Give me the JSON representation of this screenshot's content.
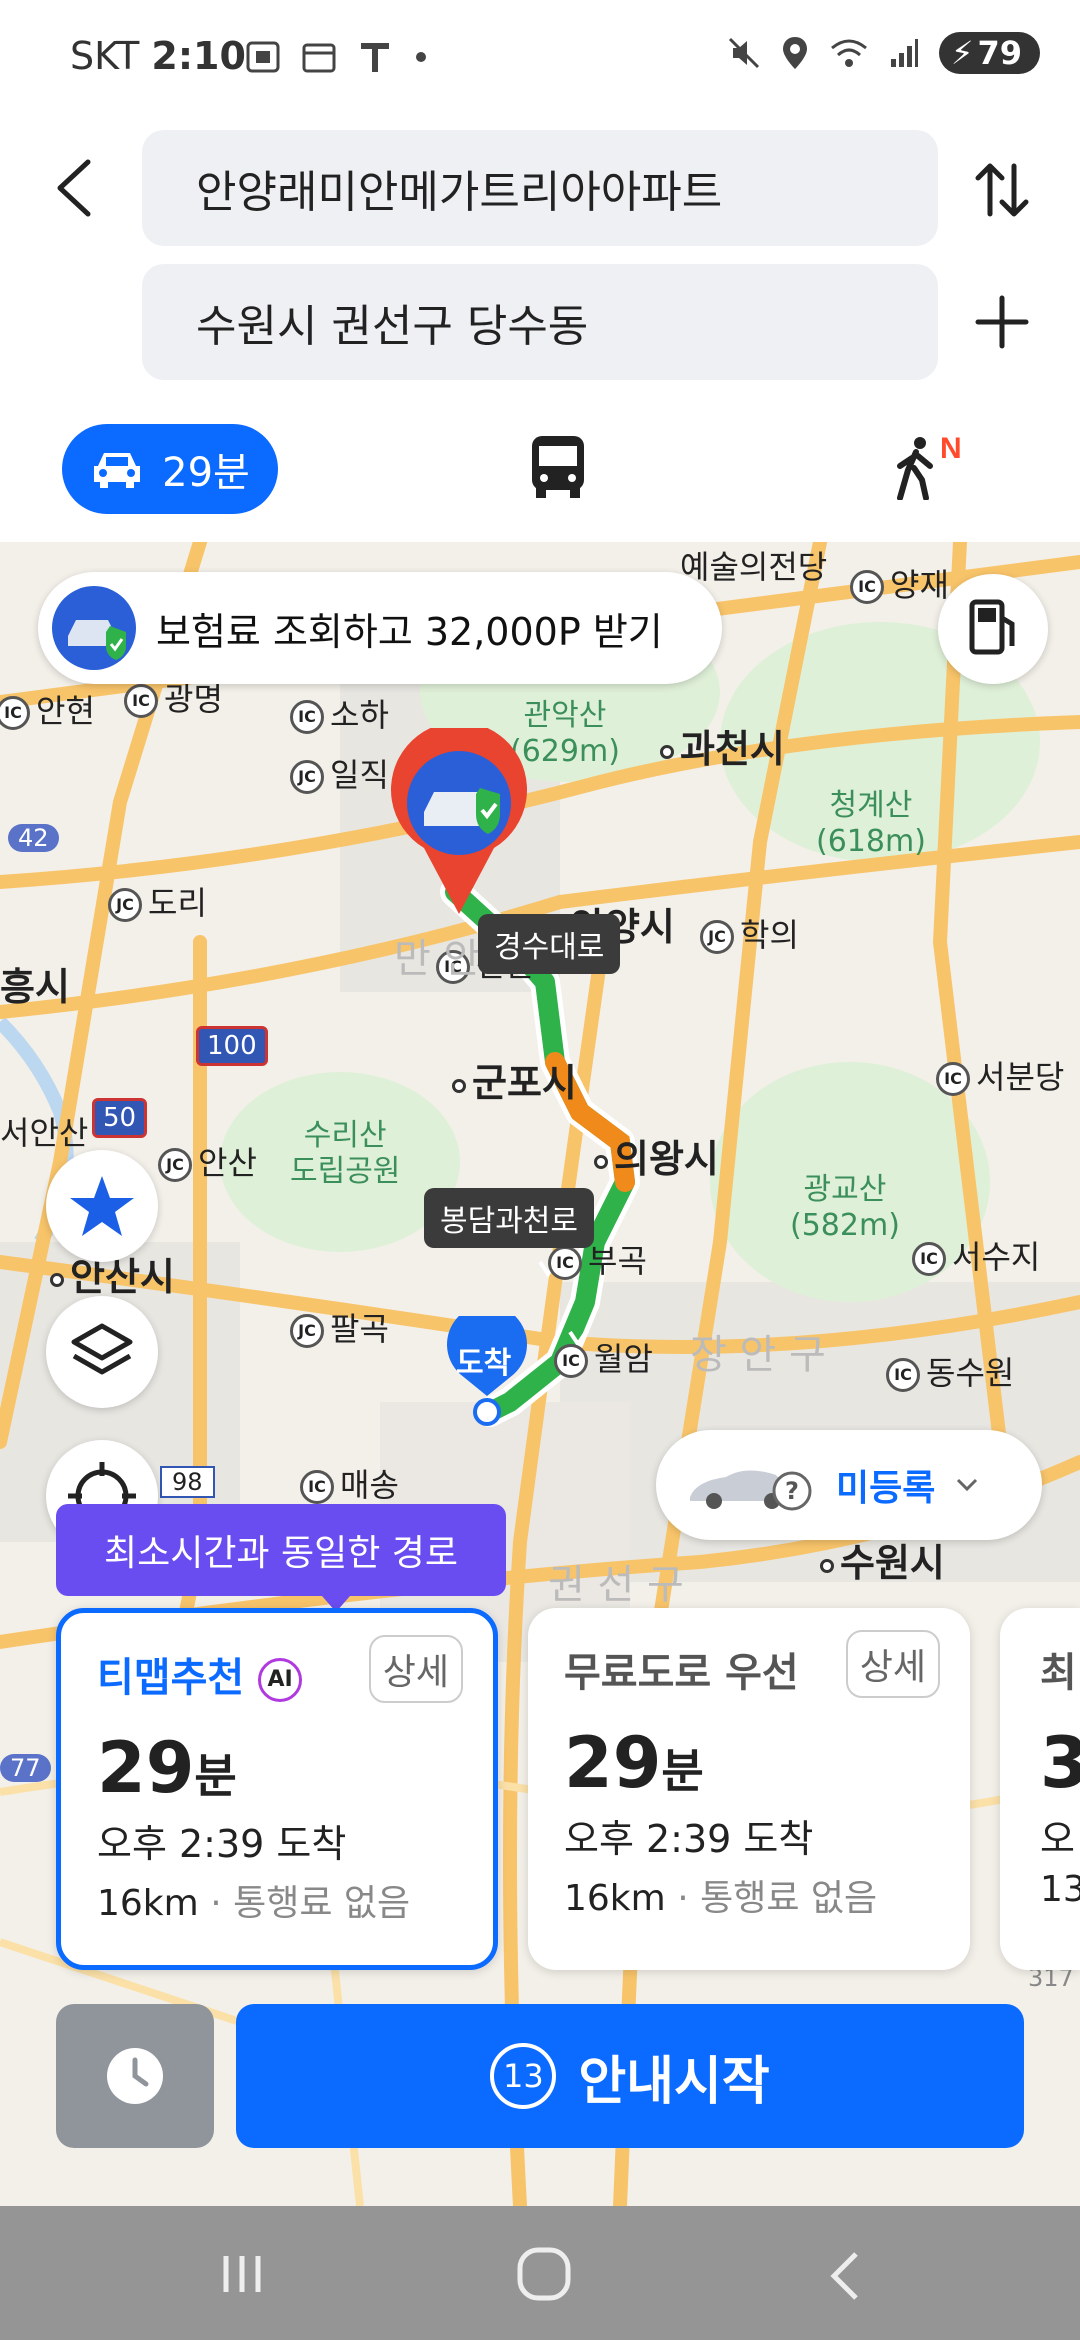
{
  "status_bar": {
    "carrier": "SKT",
    "time": "2:10",
    "battery": "79"
  },
  "search": {
    "start": "안양래미안메가트리아아파트",
    "destination": "수원시 권선구 당수동"
  },
  "modes": {
    "car_time": "29분",
    "walk_badge": "N"
  },
  "promo": {
    "text": "보험료 조회하고 32,000P 받기"
  },
  "map": {
    "labels": [
      {
        "text": "예술의전당",
        "kind": "normal"
      },
      {
        "text": "양재",
        "kind": "ic"
      },
      {
        "text": "안현",
        "kind": "ic"
      },
      {
        "text": "광명",
        "kind": "ic"
      },
      {
        "text": "소하",
        "kind": "ic"
      },
      {
        "text": "일직",
        "kind": "jc"
      },
      {
        "text": "관악산\n(629m)",
        "kind": "green"
      },
      {
        "text": "과천시",
        "kind": "city"
      },
      {
        "text": "청계산\n(618m)",
        "kind": "green"
      },
      {
        "text": "도리",
        "kind": "jc"
      },
      {
        "text": "안양시",
        "kind": "city"
      },
      {
        "text": "학의",
        "kind": "jc"
      },
      {
        "text": "흥시",
        "kind": "city"
      },
      {
        "text": "산본",
        "kind": "ic"
      },
      {
        "text": "서분당",
        "kind": "ic"
      },
      {
        "text": "군포시",
        "kind": "city"
      },
      {
        "text": "서안산",
        "kind": "normal"
      },
      {
        "text": "안산",
        "kind": "jc"
      },
      {
        "text": "수리산\n도립공원",
        "kind": "green"
      },
      {
        "text": "의왕시",
        "kind": "city"
      },
      {
        "text": "광교산\n(582m)",
        "kind": "green"
      },
      {
        "text": "안산시",
        "kind": "city"
      },
      {
        "text": "부곡",
        "kind": "ic"
      },
      {
        "text": "서수지",
        "kind": "ic"
      },
      {
        "text": "팔곡",
        "kind": "jc"
      },
      {
        "text": "월암",
        "kind": "ic"
      },
      {
        "text": "장 안 구",
        "kind": "faint"
      },
      {
        "text": "동수원",
        "kind": "ic"
      },
      {
        "text": "매송",
        "kind": "ic"
      },
      {
        "text": "권 선 구",
        "kind": "faint"
      },
      {
        "text": "수원시",
        "kind": "city"
      },
      {
        "text": "만 안",
        "kind": "faint"
      }
    ],
    "shields": [
      "42",
      "100",
      "50",
      "98",
      "77",
      "317"
    ],
    "road_tags": [
      "경수대로",
      "봉담과천로"
    ],
    "arrival_label": "도착"
  },
  "vehicle": {
    "label": "미등록"
  },
  "route_banner": "최소시간과 동일한 경로",
  "routes": [
    {
      "title": "티맵추천",
      "badge": "AI",
      "detail": "상세",
      "minutes": "29",
      "unit": "분",
      "arrive": "오후 2:39 도착",
      "distance": "16km",
      "toll": "통행료 없음"
    },
    {
      "title": "무료도로 우선",
      "badge": "",
      "detail": "상세",
      "minutes": "29",
      "unit": "분",
      "arrive": "오후 2:39 도착",
      "distance": "16km",
      "toll": "통행료 없음"
    },
    {
      "title": "최",
      "badge": "",
      "detail": "",
      "minutes": "3",
      "unit": "",
      "arrive": "오",
      "distance": "13",
      "toll": ""
    }
  ],
  "start_button": {
    "label": "안내시작",
    "countdown": "13"
  },
  "colors": {
    "accent": "#0b6aff",
    "route_green": "#2fb24a",
    "route_orange": "#f08a1a",
    "banner_purple": "#6a4df0"
  }
}
